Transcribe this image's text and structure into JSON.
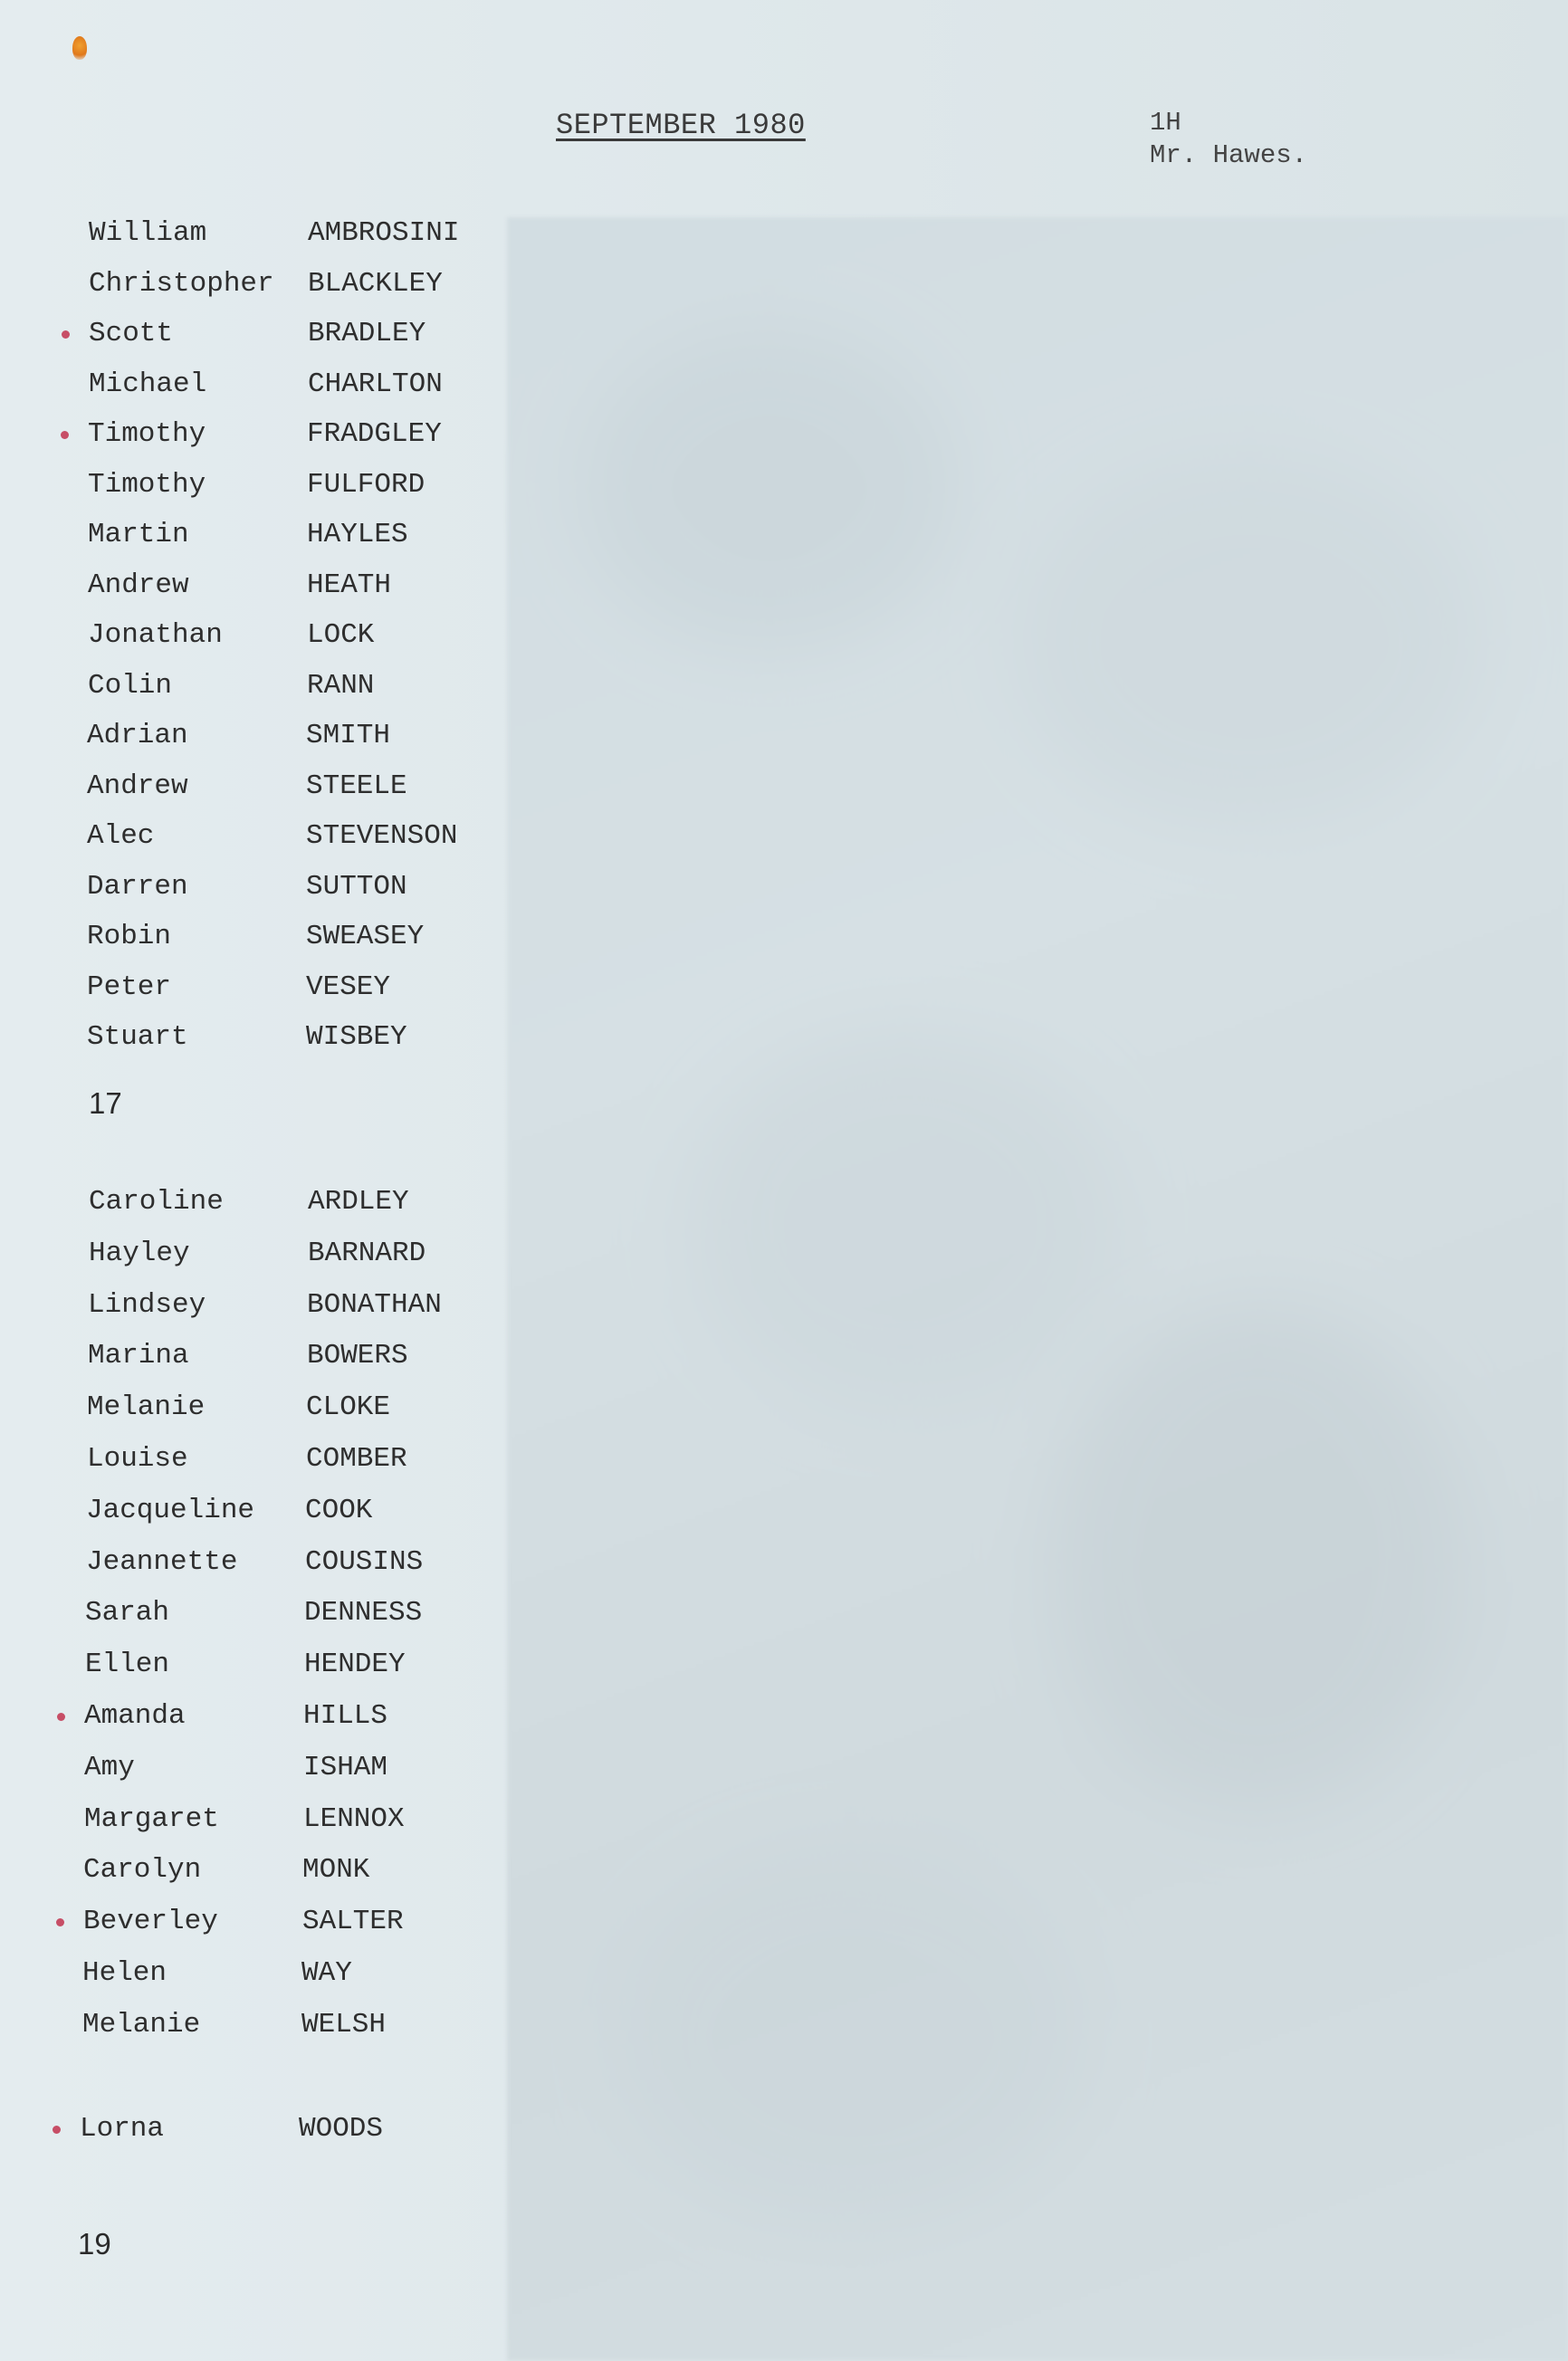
{
  "header": {
    "title": "SEPTEMBER 1980",
    "class_code": "1H",
    "teacher": "Mr. Hawes."
  },
  "boys": [
    {
      "first": "William",
      "last": "AMBROSINI",
      "marked": false
    },
    {
      "first": "Christopher",
      "last": "BLACKLEY",
      "marked": false
    },
    {
      "first": "Scott",
      "last": "BRADLEY",
      "marked": true
    },
    {
      "first": "Michael",
      "last": "CHARLTON",
      "marked": false
    },
    {
      "first": "Timothy",
      "last": "FRADGLEY",
      "marked": true
    },
    {
      "first": "Timothy",
      "last": "FULFORD",
      "marked": false
    },
    {
      "first": "Martin",
      "last": "HAYLES",
      "marked": false
    },
    {
      "first": "Andrew",
      "last": "HEATH",
      "marked": false
    },
    {
      "first": "Jonathan",
      "last": "LOCK",
      "marked": false
    },
    {
      "first": "Colin",
      "last": "RANN",
      "marked": false
    },
    {
      "first": "Adrian",
      "last": "SMITH",
      "marked": false
    },
    {
      "first": "Andrew",
      "last": "STEELE",
      "marked": false
    },
    {
      "first": "Alec",
      "last": "STEVENSON",
      "marked": false
    },
    {
      "first": "Darren",
      "last": "SUTTON",
      "marked": false
    },
    {
      "first": "Robin",
      "last": "SWEASEY",
      "marked": false
    },
    {
      "first": "Peter",
      "last": "VESEY",
      "marked": false
    },
    {
      "first": "Stuart",
      "last": "WISBEY",
      "marked": false
    }
  ],
  "boys_count": "17",
  "girls": [
    {
      "first": "Caroline",
      "last": "ARDLEY",
      "marked": false
    },
    {
      "first": "Hayley",
      "last": "BARNARD",
      "marked": false
    },
    {
      "first": "Lindsey",
      "last": "BONATHAN",
      "marked": false
    },
    {
      "first": "Marina",
      "last": "BOWERS",
      "marked": false
    },
    {
      "first": "Melanie",
      "last": "CLOKE",
      "marked": false
    },
    {
      "first": "Louise",
      "last": "COMBER",
      "marked": false
    },
    {
      "first": "Jacqueline",
      "last": "COOK",
      "marked": false
    },
    {
      "first": "Jeannette",
      "last": "COUSINS",
      "marked": false
    },
    {
      "first": "Sarah",
      "last": "DENNESS",
      "marked": false
    },
    {
      "first": "Ellen",
      "last": "HENDEY",
      "marked": false
    },
    {
      "first": "Amanda",
      "last": "HILLS",
      "marked": true
    },
    {
      "first": "Amy",
      "last": "ISHAM",
      "marked": false
    },
    {
      "first": "Margaret",
      "last": "LENNOX",
      "marked": false
    },
    {
      "first": "Carolyn",
      "last": "MONK",
      "marked": false
    },
    {
      "first": "Beverley",
      "last": "SALTER",
      "marked": true
    },
    {
      "first": "Helen",
      "last": "WAY",
      "marked": false
    },
    {
      "first": "Melanie",
      "last": "WELSH",
      "marked": false
    }
  ],
  "late_addition": {
    "first": "Lorna",
    "last": "WOODS",
    "marked": true
  },
  "girls_count": "19",
  "colors": {
    "paper": "#e4ecef",
    "ink": "#2e2e2e",
    "tick_mark": "#c2334d",
    "stain": "#e0781a"
  }
}
